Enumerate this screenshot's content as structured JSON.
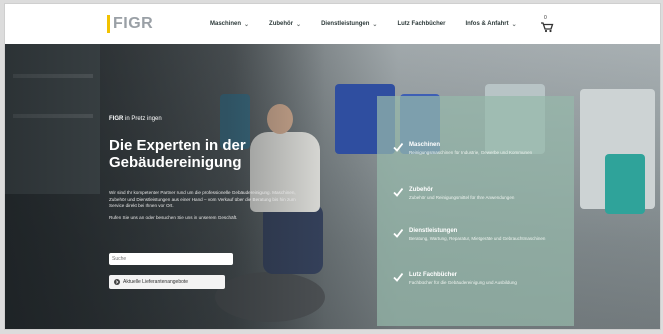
{
  "brand": {
    "logo_text": "FIGR",
    "accent": "#f2c200"
  },
  "nav": {
    "items": [
      {
        "label": "Maschinen",
        "has_dropdown": true
      },
      {
        "label": "Zubehör",
        "has_dropdown": true
      },
      {
        "label": "Dienstleistungen",
        "has_dropdown": true
      },
      {
        "label": "Lutz Fachbücher",
        "has_dropdown": false
      },
      {
        "label": "Infos & Anfahrt",
        "has_dropdown": true
      }
    ],
    "cart_count": "0"
  },
  "hero": {
    "tagline_brand": "FIGR",
    "tagline_rest": " in Pretz ingen",
    "headline": "Die Experten in der Gebäudereinigung",
    "paragraph_1": "Wir sind Ihr kompetenter Partner rund um die professionelle Gebäudereinigung. Maschinen, Zubehör und Dienstleistungen aus einer Hand – vom Verkauf über die Beratung bis hin zum Service direkt bei Ihnen vor Ort.",
    "paragraph_2": "Rufen Sie uns an oder besuchen Sie uns in unserem Geschäft.",
    "search_placeholder": "Suche",
    "cta_label": "Aktuelle Lieferantenangebote"
  },
  "features": [
    {
      "title": "Maschinen",
      "desc": "Reinigungsmaschinen für Industrie, Gewerbe und Kommunen"
    },
    {
      "title": "Zubehör",
      "desc": "Zubehör und Reinigungsmittel für Ihre Anwendungen"
    },
    {
      "title": "Dienstleistungen",
      "desc": "Beratung, Wartung, Reparatur, Mietgeräte und Gebrauchtmaschinen"
    },
    {
      "title": "Lutz Fachbücher",
      "desc": "Fachbücher für die Gebäudereinigung und Ausbildung"
    }
  ],
  "colors": {
    "panel": "#96b9aa",
    "nav_text": "#2d3a3a"
  }
}
